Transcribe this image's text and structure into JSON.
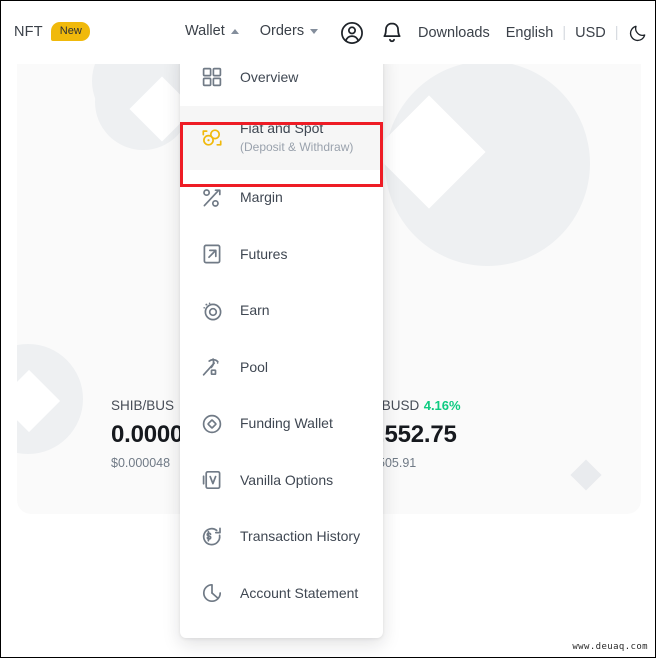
{
  "header": {
    "brand_label": "NFT",
    "brand_badge": "New",
    "nav": [
      {
        "label": "Wallet",
        "caret": "caret-up-icon",
        "active": true
      },
      {
        "label": "Orders",
        "caret": "caret-down-icon",
        "active": false
      }
    ],
    "icons": [
      {
        "name": "user-account-icon"
      },
      {
        "name": "notification-bell-icon"
      }
    ],
    "links": [
      {
        "label": "Downloads"
      },
      {
        "label": "English"
      },
      {
        "label": "USD"
      }
    ],
    "separator": "|",
    "theme_toggle": "dark-mode-moon-icon",
    "colors": {
      "badge_bg": "#f0b90b",
      "text": "#3b4149"
    }
  },
  "background": {
    "tickers": [
      {
        "pair": "SHIB/BUS",
        "change": "",
        "price": "0.0000",
        "usd": "$0.000048"
      },
      {
        "pair": "/BUSD",
        "change": "4.16%",
        "price": ",552.75",
        "usd": "505.91"
      }
    ],
    "colors": {
      "panel": "#fafafa",
      "deco": "#eef0f2",
      "positive": "#0ecb81"
    }
  },
  "dropdown": {
    "name": "wallet-dropdown-menu",
    "items": [
      {
        "label": "Overview",
        "sub": "",
        "icon": "grid-overview-icon"
      },
      {
        "label": "Fiat and Spot",
        "sub": "(Deposit & Withdraw)",
        "icon": "fiat-spot-coins-icon",
        "active": true
      },
      {
        "label": "Margin",
        "sub": "",
        "icon": "percent-arrow-icon"
      },
      {
        "label": "Futures",
        "sub": "",
        "icon": "futures-arrow-box-icon"
      },
      {
        "label": "Earn",
        "sub": "",
        "icon": "earn-orbit-icon"
      },
      {
        "label": "Pool",
        "sub": "",
        "icon": "pool-pickaxe-icon"
      },
      {
        "label": "Funding Wallet",
        "sub": "",
        "icon": "funding-diamond-circle-icon"
      },
      {
        "label": "Vanilla Options",
        "sub": "",
        "icon": "vanilla-options-v-icon"
      },
      {
        "label": "Transaction History",
        "sub": "",
        "icon": "transaction-history-clock-icon"
      },
      {
        "label": "Account Statement",
        "sub": "",
        "icon": "account-statement-pie-icon"
      }
    ],
    "highlight": {
      "target": "Fiat and Spot",
      "color": "#ee1c25"
    }
  },
  "watermark": {
    "text": "www.deuaq.com"
  }
}
